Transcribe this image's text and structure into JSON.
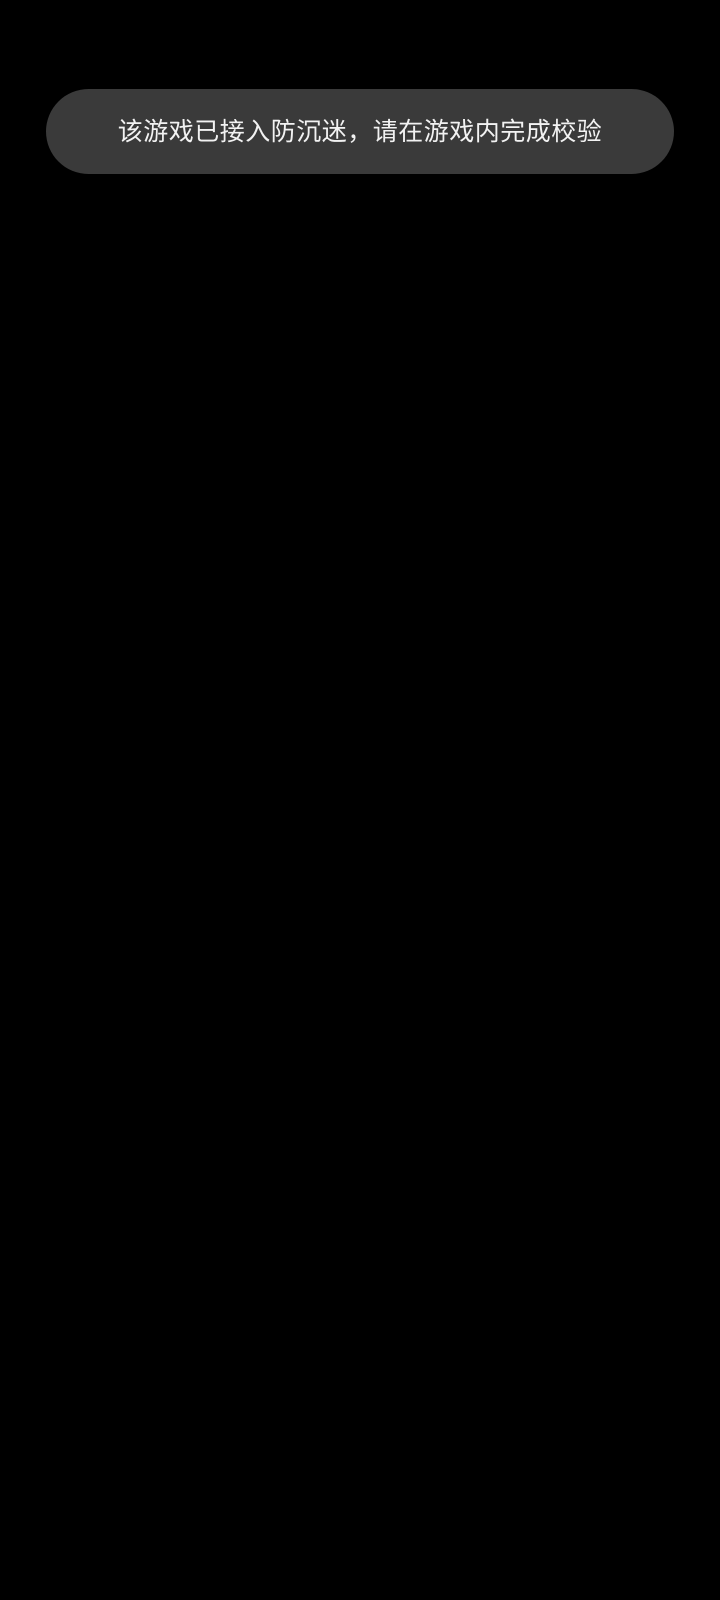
{
  "toast": {
    "message": "该游戏已接入防沉迷，请在游戏内完成校验"
  },
  "colors": {
    "background": "#000000",
    "toast_background": "#3a3a3a",
    "toast_text": "#f2f2f2"
  }
}
